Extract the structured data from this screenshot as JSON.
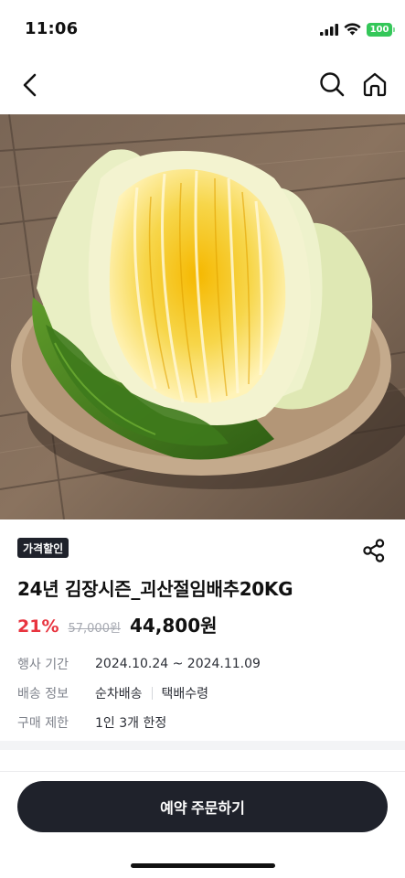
{
  "status_bar": {
    "time": "11:06",
    "battery": "100"
  },
  "nav": {
    "back_icon": "chevron-left-icon",
    "search_icon": "search-icon",
    "home_icon": "home-icon"
  },
  "product": {
    "badge": "가격할인",
    "title": "24년 김장시즌_괴산절임배추20KG",
    "discount_rate": "21%",
    "original_price": "57,000원",
    "sale_price": "44,800원",
    "share_icon": "share-icon"
  },
  "info": {
    "period_label": "행사 기간",
    "period_value": "2024.10.24 ~ 2024.11.09",
    "shipping_label": "배송 정보",
    "shipping_values": [
      "순차배송",
      "택배수령"
    ],
    "limit_label": "구매 제한",
    "limit_value": "1인 3개 한정"
  },
  "cta": {
    "label": "예약 주문하기"
  },
  "colors": {
    "accent_red": "#e8343f",
    "dark": "#1f222b",
    "battery_green": "#34c759"
  }
}
